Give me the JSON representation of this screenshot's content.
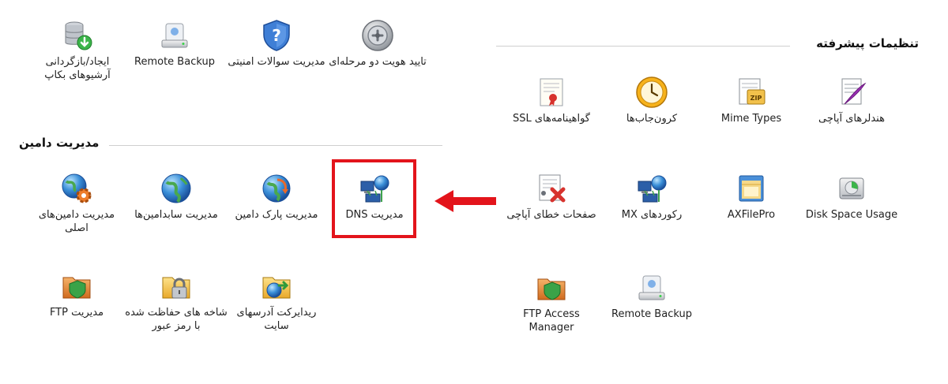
{
  "top_row": {
    "two_factor": "تایید هویت دو مرحله‌ای",
    "security_questions": "مدیریت سوالات امنیتی",
    "remote_backup": "Remote Backup",
    "backup_archives": "ایجاد/بازگردانی آرشیوهای بکاپ"
  },
  "advanced": {
    "title": "تنظیمات پیشرفته",
    "items": {
      "apache_handlers": "هندلرهای آپاچی",
      "mime_types": "Mime Types",
      "cron_jobs": "کرون‌جاب‌ها",
      "ssl_certificates": "گواهینامه‌های SSL",
      "disk_space": "Disk Space Usage",
      "axfilepro": "AXFilePro",
      "mx_records": "رکوردهای MX",
      "apache_error_pages": "صفحات خطای آپاچی",
      "remote_backup": "Remote Backup",
      "ftp_access_manager": "FTP Access Manager"
    }
  },
  "domain": {
    "title": "مدیریت دامین",
    "items": {
      "dns_management": "مدیریت DNS",
      "parked_domains": "مدیریت پارک دامین",
      "subdomains": "مدیریت سابدامین‌ها",
      "main_domains": "مدیریت دامین‌های اصلی",
      "redirects": "ریدایرکت آدرسهای سایت",
      "protected_dirs": "شاخه های حفاظت شده با رمز عبور",
      "ftp_management": "مدیریت FTP"
    }
  },
  "colors": {
    "highlight": "#e3141b",
    "arrow": "#e3141b"
  },
  "icons": {
    "two_factor": "dial-gear-icon",
    "security_questions": "shield-question-icon",
    "remote_backup": "drive-icon",
    "backup_archives": "database-download-icon",
    "apache_handlers": "document-feather-icon",
    "mime_types": "zip-file-icon",
    "cron_jobs": "clock-icon",
    "ssl_certificates": "certificate-icon",
    "disk_space": "hard-disk-pie-icon",
    "axfilepro": "file-window-icon",
    "mx_records": "network-globe-icon",
    "apache_error_pages": "error-page-icon",
    "ftp_access_manager": "folder-shield-icon",
    "dns_management": "network-globe-icon",
    "parked_domains": "globe-arrow-icon",
    "subdomains": "globe-icon",
    "main_domains": "globe-gear-icon",
    "redirects": "folder-globe-icon",
    "protected_dirs": "folder-lock-icon",
    "ftp_management": "folder-shield-icon"
  }
}
